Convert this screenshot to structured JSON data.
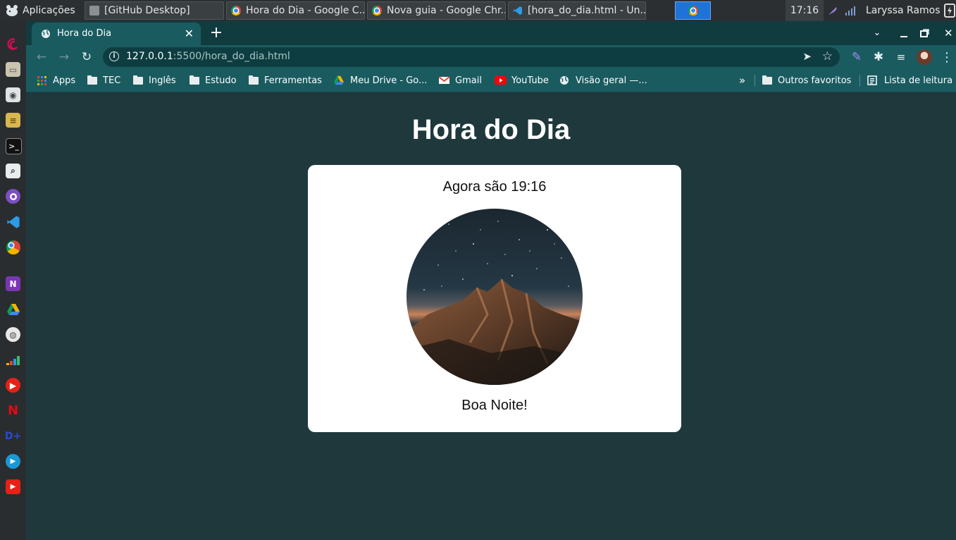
{
  "panel": {
    "apps_label": "Aplicações",
    "tasks": [
      {
        "label": "[GitHub Desktop]"
      },
      {
        "label": "Hora do Dia - Google C..."
      },
      {
        "label": "Nova guia - Google Chr..."
      },
      {
        "label": "[hora_do_dia.html - Un..."
      }
    ],
    "clock": "17:16",
    "user": "Laryssa Ramos"
  },
  "browser": {
    "tab_title": "Hora do Dia",
    "url_host": "127.0.0.1",
    "url_path": ":5500/hora_do_dia.html",
    "bookmarks": [
      {
        "label": "Apps",
        "icon": "apps-grid-icon"
      },
      {
        "label": "TEC",
        "icon": "folder-icon"
      },
      {
        "label": "Inglês",
        "icon": "folder-icon"
      },
      {
        "label": "Estudo",
        "icon": "folder-icon"
      },
      {
        "label": "Ferramentas",
        "icon": "folder-icon"
      },
      {
        "label": "Meu Drive - Go...",
        "icon": "google-drive-icon"
      },
      {
        "label": "Gmail",
        "icon": "gmail-icon"
      },
      {
        "label": "YouTube",
        "icon": "youtube-icon"
      },
      {
        "label": "Visão geral —...",
        "icon": "globe-icon"
      }
    ],
    "more_bookmarks": "»",
    "other_favorites": "Outros favoritos",
    "reading_list": "Lista de leitura"
  },
  "page": {
    "title": "Hora do Dia",
    "time_message": "Agora são 19:16",
    "greeting": "Boa Noite!"
  },
  "colors": {
    "page_background": "#1f383c",
    "browser_frame": "#1a5b60",
    "card": "#ffffff"
  }
}
